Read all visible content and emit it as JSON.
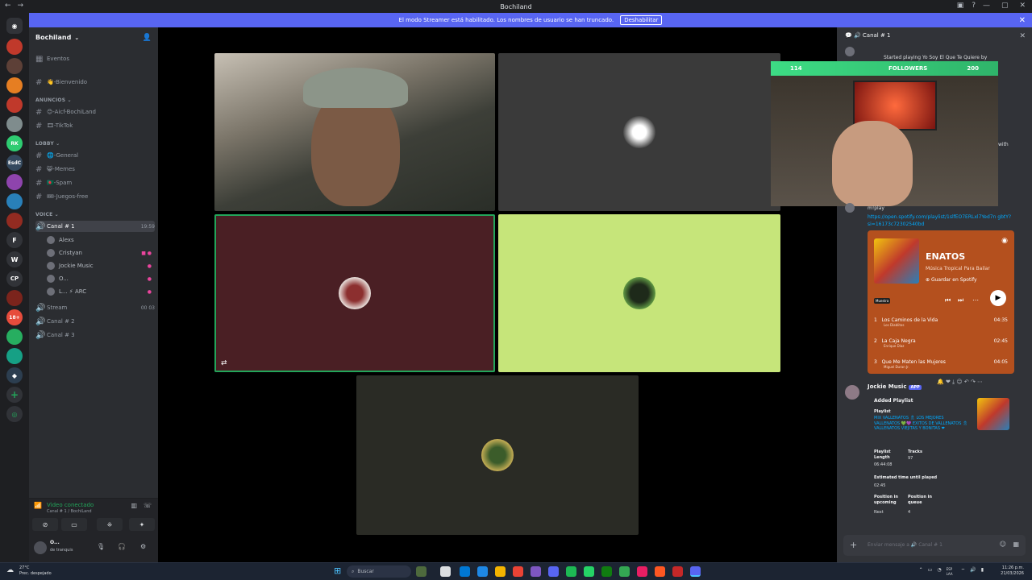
{
  "window": {
    "title": "Bochiland",
    "controls": [
      "—",
      "▢",
      "✕"
    ]
  },
  "banner": {
    "text": "El modo Streamer está habilitado. Los nombres de usuario se han truncado.",
    "button": "Deshabilitar"
  },
  "guild": {
    "name": "Bochiland"
  },
  "sidebar": {
    "events": "Eventos",
    "welcome": "👋-Bienvenido",
    "cat_announce": "ANUNCIOS",
    "announce": [
      "😊-Aicf-BochiLand",
      "🎞-TikTok"
    ],
    "cat_lobby": "LOBBY",
    "lobby": [
      "🌐-General",
      "😸-Memes",
      "🇧🇩-Spam",
      "🎟-Juegos-free"
    ],
    "cat_voice": "VOICE",
    "voice_active": {
      "name": "Canal # 1",
      "time": "19:59"
    },
    "voice_users": [
      "Alexs",
      "Cristyan",
      "Jockie Music",
      "O...",
      "L... ⚡ ARC"
    ],
    "other_voice": [
      {
        "name": "Stream",
        "count": "00 03"
      },
      {
        "name": "Canal # 2"
      },
      {
        "name": "Canal # 3"
      }
    ],
    "voice_panel": {
      "status": "Video conectado",
      "sub": "Canal # 1 / BochiLand"
    },
    "user": {
      "name": "O...",
      "status": "de tranquis"
    }
  },
  "rail_letters": [
    "F",
    "W",
    "CP"
  ],
  "chat": {
    "channel": "Canal # 1",
    "started_playing": "Started playing Yo Soy El Que Te Quiere by",
    "with_text": "with",
    "cmd": "m!play",
    "link": "https://open.spotify.com/playlist/1slfEO7ERLxl7Yed7n gbtY?si=16173c72302540bd",
    "spotify": {
      "title": "ENATOS",
      "sub": "Música Tropical Para Bailar",
      "save": "Guardar en Spotify",
      "tag": "Muestra",
      "tracks": [
        {
          "n": "1",
          "name": "Los Caminos de la Vida",
          "artist": "Los Diablitos",
          "dur": "04:35"
        },
        {
          "n": "2",
          "name": "La Caja Negra",
          "artist": "Enrique Díaz",
          "dur": "02:45"
        },
        {
          "n": "3",
          "name": "Que Me Maten las Mujeres",
          "artist": "Miguel Duran Jr.",
          "dur": "04:05"
        }
      ]
    },
    "jockie": {
      "name": "Jockie Music",
      "app": "APP",
      "added": "Added Playlist",
      "playlist_label": "Playlist",
      "playlist": "MIX VALLENATOS 🎗 LOS MEJORES VALLENATOS 💚💜 EXITOS DE VALLENATOS 🎗 VALLENATOS VIEJITAS Y BONITAS ❤",
      "length_label": "Playlist Length",
      "length": "06:44:08",
      "tracks_label": "Tracks",
      "tracks": "97",
      "est_label": "Estimated time until played",
      "est": "02:45",
      "pos_up_label": "Position in upcoming",
      "pos_up": "Next",
      "pos_q_label": "Position in queue",
      "pos_q": "4"
    },
    "placeholder": "Enviar mensaje a 🔊 Canal # 1"
  },
  "overlay": {
    "count_left": "114",
    "label": "FOLLOWERS",
    "count_right": "200"
  },
  "taskbar": {
    "weather": "27°C",
    "weather_sub": "Prec. despejado",
    "search": "Buscar",
    "lang": "ESP LAA",
    "time": "11:26 p.m.",
    "date": "21/03/2026"
  }
}
